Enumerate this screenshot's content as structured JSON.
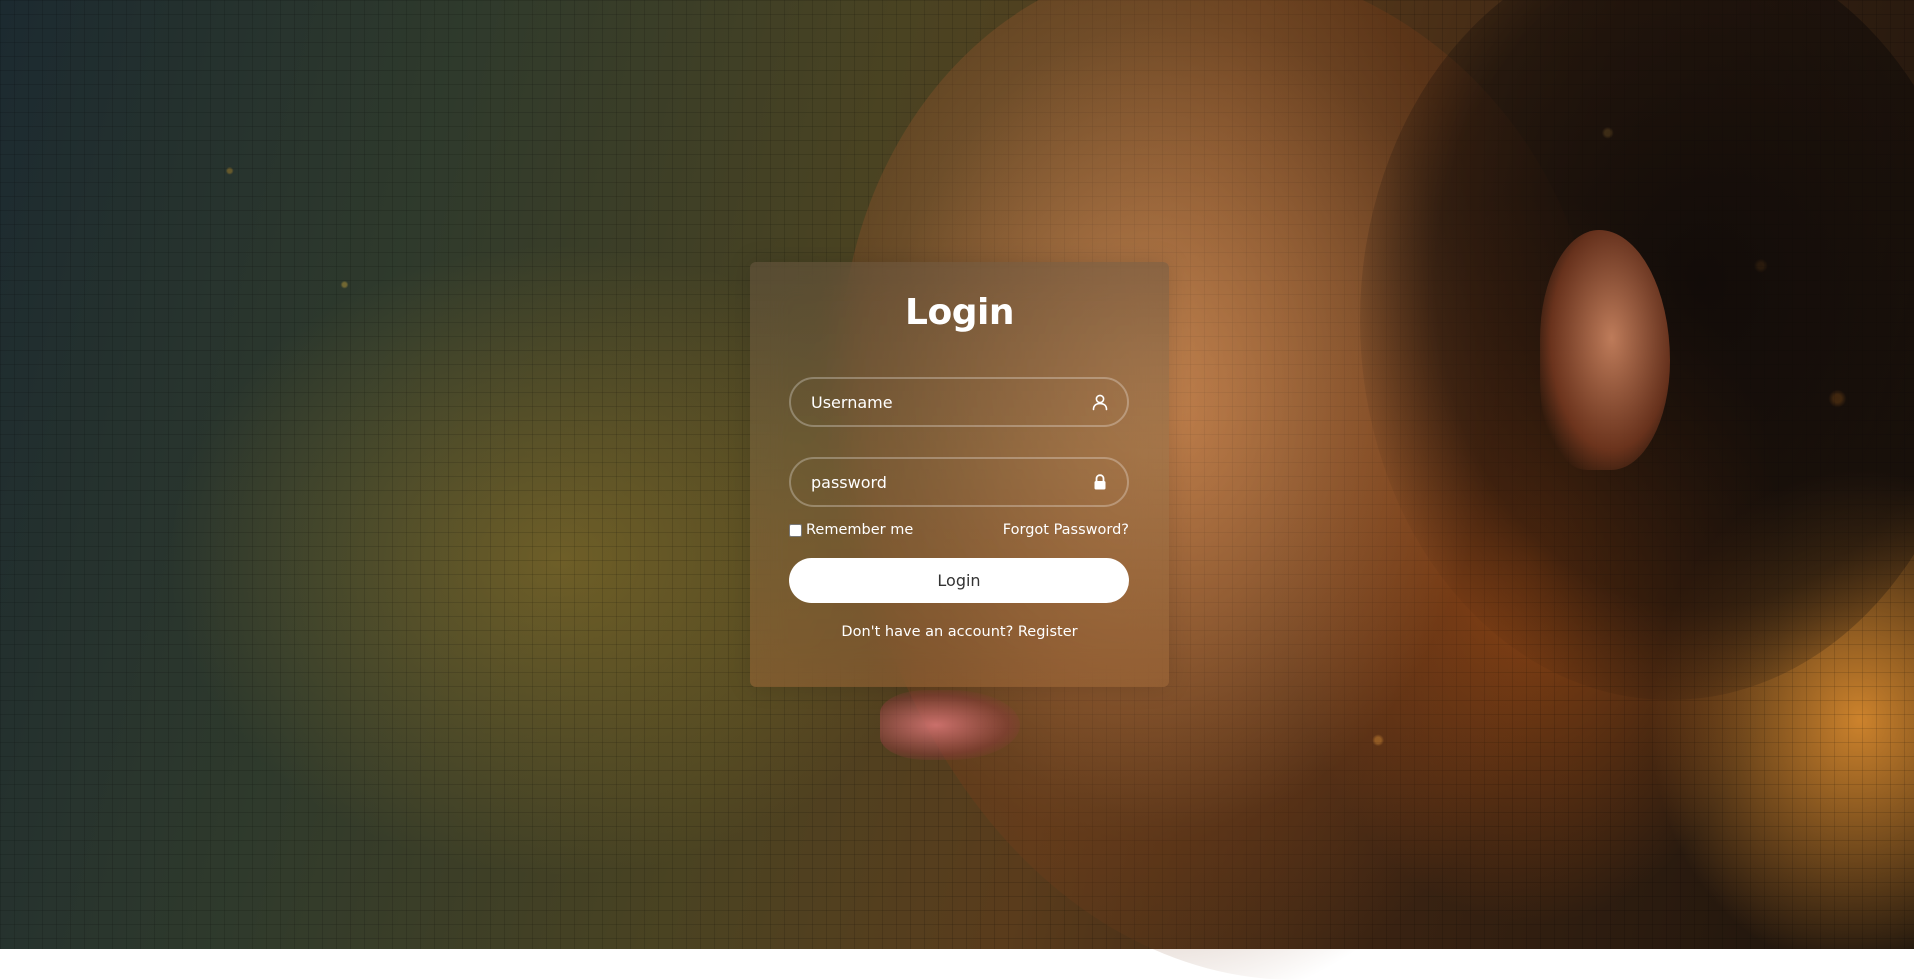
{
  "login_form": {
    "title": "Login",
    "username": {
      "placeholder": "Username",
      "value": "",
      "icon": "user-icon"
    },
    "password": {
      "placeholder": "password",
      "value": "",
      "icon": "lock-icon"
    },
    "remember_me": {
      "label": "Remember me",
      "checked": false
    },
    "forgot_password_label": "Forgot Password?",
    "submit_label": "Login",
    "register_prompt": "Don't have an account?",
    "register_label": "Register"
  },
  "colors": {
    "text": "#ffffff",
    "button_bg": "#ffffff",
    "button_text": "#333333",
    "field_border": "rgba(255,255,255,0.28)"
  }
}
